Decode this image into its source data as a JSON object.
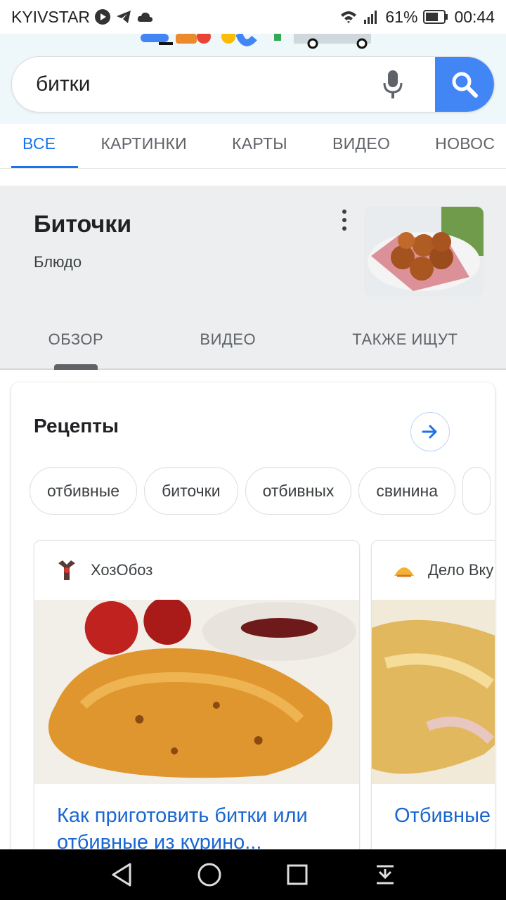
{
  "status_bar": {
    "carrier": "KYIVSTAR",
    "battery": "61%",
    "time": "00:44"
  },
  "search": {
    "query": "битки"
  },
  "tabs": [
    {
      "label": "ВСЕ",
      "active": true
    },
    {
      "label": "КАРТИНКИ",
      "active": false
    },
    {
      "label": "КАРТЫ",
      "active": false
    },
    {
      "label": "ВИДЕО",
      "active": false
    },
    {
      "label": "НОВОС",
      "active": false
    }
  ],
  "knowledge_panel": {
    "title": "Биточки",
    "subtitle": "Блюдо",
    "tabs": [
      {
        "label": "ОБЗОР",
        "active": true
      },
      {
        "label": "ВИДЕО",
        "active": false
      },
      {
        "label": "ТАКЖЕ ИЩУТ",
        "active": false
      }
    ]
  },
  "recipes": {
    "title": "Рецепты",
    "chips": [
      "отбивные",
      "биточки",
      "отбивных",
      "свинина",
      ""
    ],
    "cards": [
      {
        "source": "ХозОбоз",
        "title": "Как приготовить битки или отбивные из курино..."
      },
      {
        "source": "Дело Вку",
        "title": "Отбивные Как приго"
      }
    ]
  },
  "colors": {
    "accent": "#1a73e8",
    "search_button": "#4285f4",
    "link": "#1967d2"
  }
}
